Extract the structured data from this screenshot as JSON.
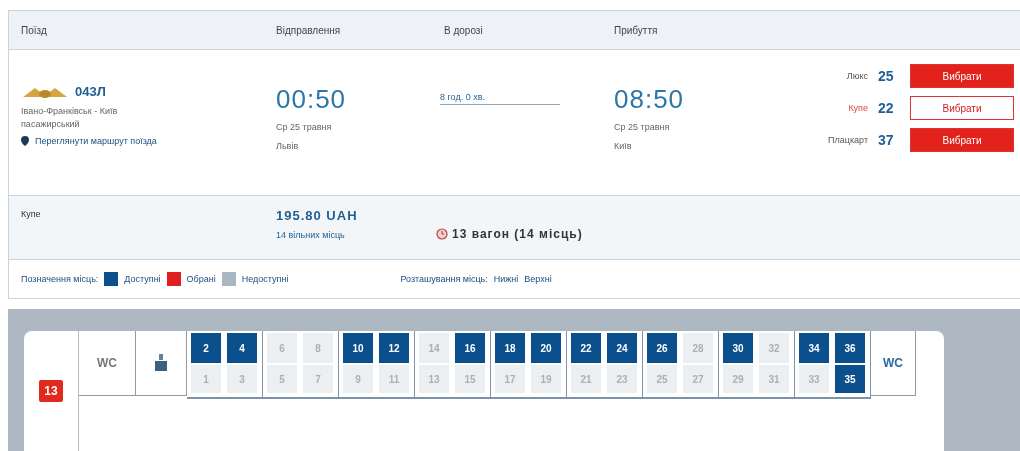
{
  "table": {
    "columns": [
      "Поїзд",
      "Відправлення",
      "В дорозі",
      "Прибуття"
    ]
  },
  "train": {
    "number": "043Л",
    "route": "Івано-Франківськ - Київ пасажирський",
    "route_link": "Переглянути маршрут поїзда",
    "departure": {
      "time": "00:50",
      "date": "Ср 25 травня",
      "station": "Львів"
    },
    "duration": "8 год. 0 хв.",
    "arrival": {
      "time": "08:50",
      "date": "Ср 25 травня",
      "station": "Київ"
    },
    "classes": [
      {
        "name": "Люкс",
        "count": "25",
        "button": "Вибрати",
        "selected": false
      },
      {
        "name": "Купе",
        "count": "22",
        "button": "Вибрати",
        "selected": true
      },
      {
        "name": "Плацкарт",
        "count": "37",
        "button": "Вибрати",
        "selected": false
      }
    ]
  },
  "car_info": {
    "class": "Купе",
    "price": "195.80 UAH",
    "free": "14 вільних місць",
    "car": "13 вагон (14 місць)"
  },
  "legend": {
    "label": "Позначення місць:",
    "items": [
      {
        "text": "Доступні",
        "color": "#0b4f8c"
      },
      {
        "text": "Обрані",
        "color": "#e02020"
      },
      {
        "text": "Недоступні",
        "color": "#a9b6c4"
      }
    ],
    "placement_label": "Розташування місць:",
    "placement": [
      "Нижні",
      "Верхні"
    ]
  },
  "car_map": {
    "car_number": "13",
    "end_labels": [
      "WC",
      "WC"
    ],
    "compartments": [
      {
        "seats": [
          {
            "number": "2",
            "available": true
          },
          {
            "number": "4",
            "available": true
          },
          {
            "number": "1",
            "available": false
          },
          {
            "number": "3",
            "available": false
          }
        ]
      },
      {
        "seats": [
          {
            "number": "6",
            "available": false
          },
          {
            "number": "8",
            "available": false
          },
          {
            "number": "5",
            "available": false
          },
          {
            "number": "7",
            "available": false
          }
        ]
      },
      {
        "seats": [
          {
            "number": "10",
            "available": true
          },
          {
            "number": "12",
            "available": true
          },
          {
            "number": "9",
            "available": false
          },
          {
            "number": "11",
            "available": false
          }
        ]
      },
      {
        "seats": [
          {
            "number": "14",
            "available": false
          },
          {
            "number": "16",
            "available": true
          },
          {
            "number": "13",
            "available": false
          },
          {
            "number": "15",
            "available": false
          }
        ]
      },
      {
        "seats": [
          {
            "number": "18",
            "available": true
          },
          {
            "number": "20",
            "available": true
          },
          {
            "number": "17",
            "available": false
          },
          {
            "number": "19",
            "available": false
          }
        ]
      },
      {
        "seats": [
          {
            "number": "22",
            "available": true
          },
          {
            "number": "24",
            "available": true
          },
          {
            "number": "21",
            "available": false
          },
          {
            "number": "23",
            "available": false
          }
        ]
      },
      {
        "seats": [
          {
            "number": "26",
            "available": true
          },
          {
            "number": "28",
            "available": false
          },
          {
            "number": "25",
            "available": false
          },
          {
            "number": "27",
            "available": false
          }
        ]
      },
      {
        "seats": [
          {
            "number": "30",
            "available": true
          },
          {
            "number": "32",
            "available": false
          },
          {
            "number": "29",
            "available": false
          },
          {
            "number": "31",
            "available": false
          }
        ]
      },
      {
        "seats": [
          {
            "number": "34",
            "available": true
          },
          {
            "number": "36",
            "available": true
          },
          {
            "number": "33",
            "available": false
          },
          {
            "number": "35",
            "available": true
          }
        ]
      }
    ]
  }
}
